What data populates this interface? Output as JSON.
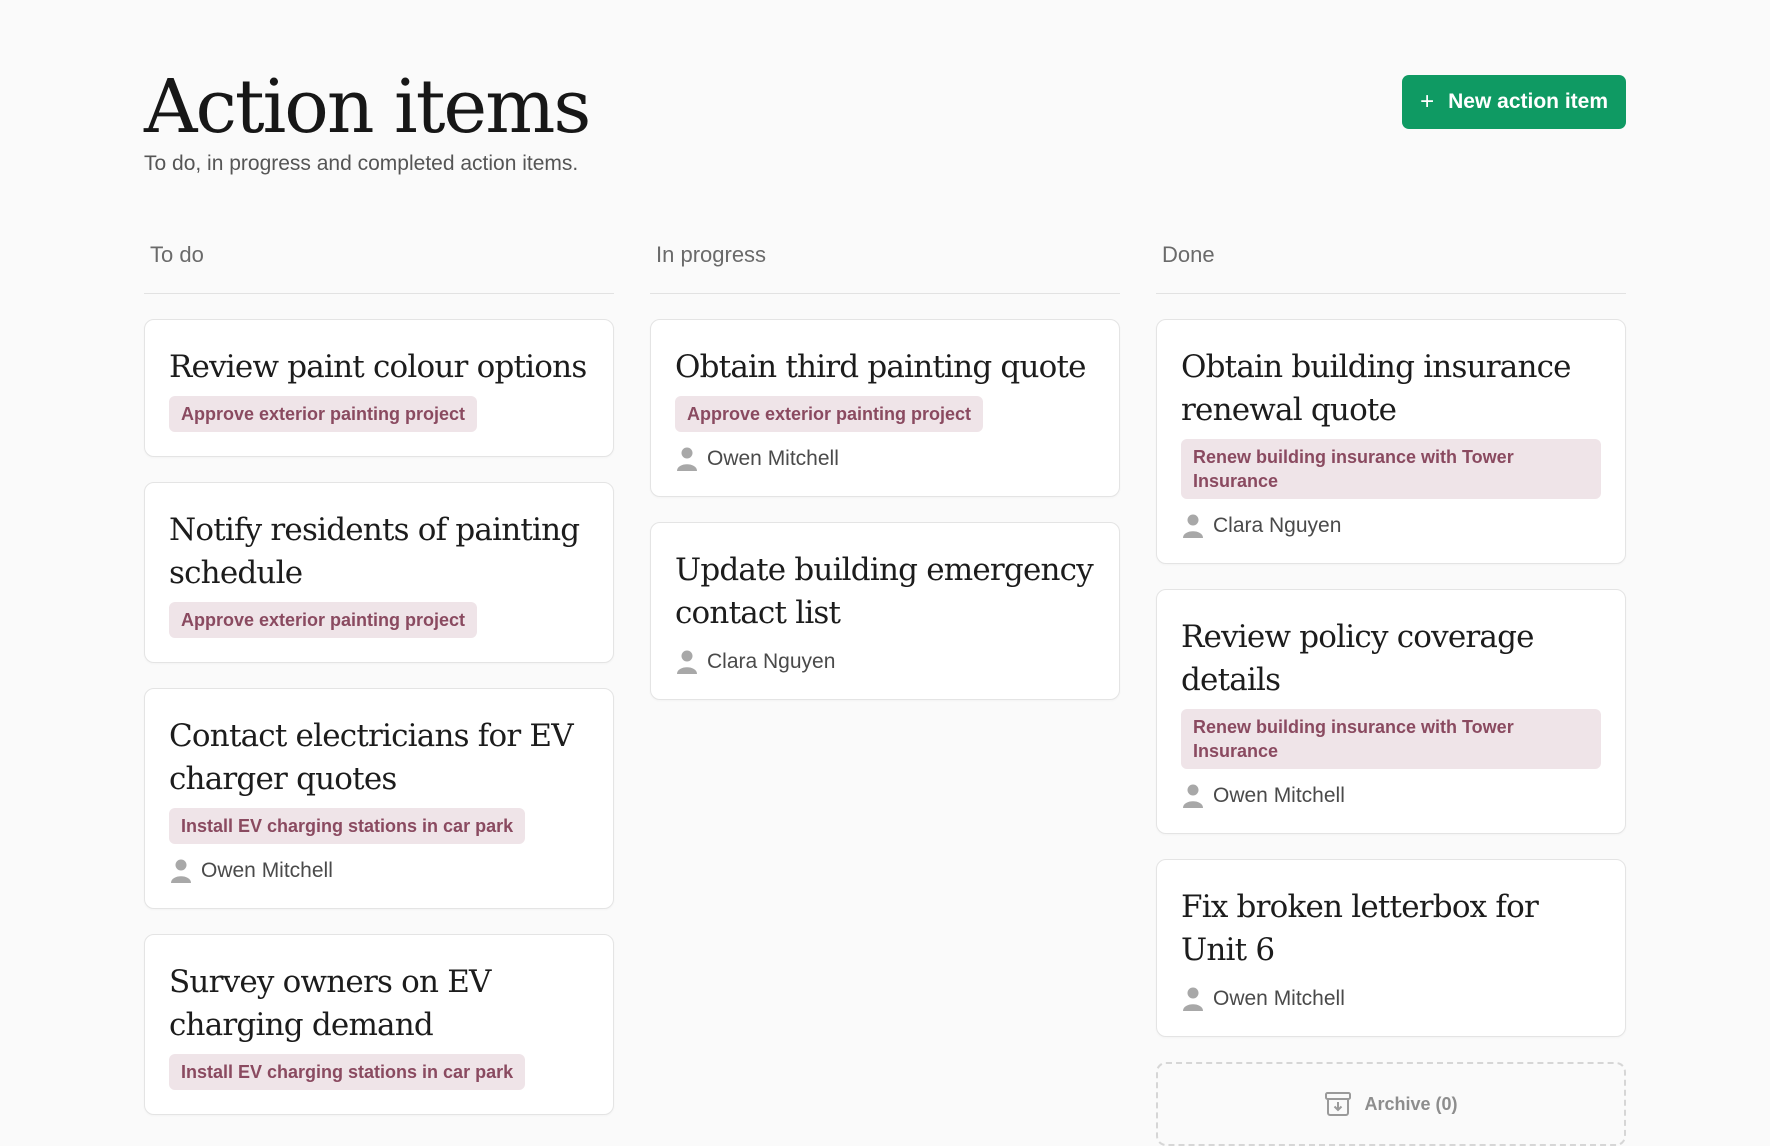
{
  "header": {
    "title": "Action items",
    "subtitle": "To do, in progress and completed action items.",
    "new_button": {
      "icon": "plus-icon",
      "label": "New action item"
    }
  },
  "colors": {
    "accent": "#0f9a63",
    "tag_background": "#efe4e8",
    "tag_text": "#8a4a60"
  },
  "columns": [
    {
      "name": "To do",
      "cards": [
        {
          "title": "Review paint colour options",
          "tag": "Approve exterior painting project",
          "assignee": ""
        },
        {
          "title": "Notify residents of painting schedule",
          "tag": "Approve exterior painting project",
          "assignee": ""
        },
        {
          "title": "Contact electricians for EV charger quotes",
          "tag": "Install EV charging stations in car park",
          "assignee": "Owen Mitchell"
        },
        {
          "title": "Survey owners on EV charging demand",
          "tag": "Install EV charging stations in car park",
          "assignee": ""
        }
      ]
    },
    {
      "name": "In progress",
      "cards": [
        {
          "title": "Obtain third painting quote",
          "tag": "Approve exterior painting project",
          "assignee": "Owen Mitchell"
        },
        {
          "title": "Update building emergency contact list",
          "tag": "",
          "assignee": "Clara Nguyen"
        }
      ]
    },
    {
      "name": "Done",
      "cards": [
        {
          "title": "Obtain building insurance renewal quote",
          "tag": "Renew building insurance with Tower Insurance",
          "assignee": "Clara Nguyen"
        },
        {
          "title": "Review policy coverage details",
          "tag": "Renew building insurance with Tower Insurance",
          "assignee": "Owen Mitchell"
        },
        {
          "title": "Fix broken letterbox for Unit 6",
          "tag": "",
          "assignee": "Owen Mitchell"
        }
      ],
      "archive": {
        "icon": "archive-icon",
        "label": "Archive (0)"
      }
    }
  ]
}
